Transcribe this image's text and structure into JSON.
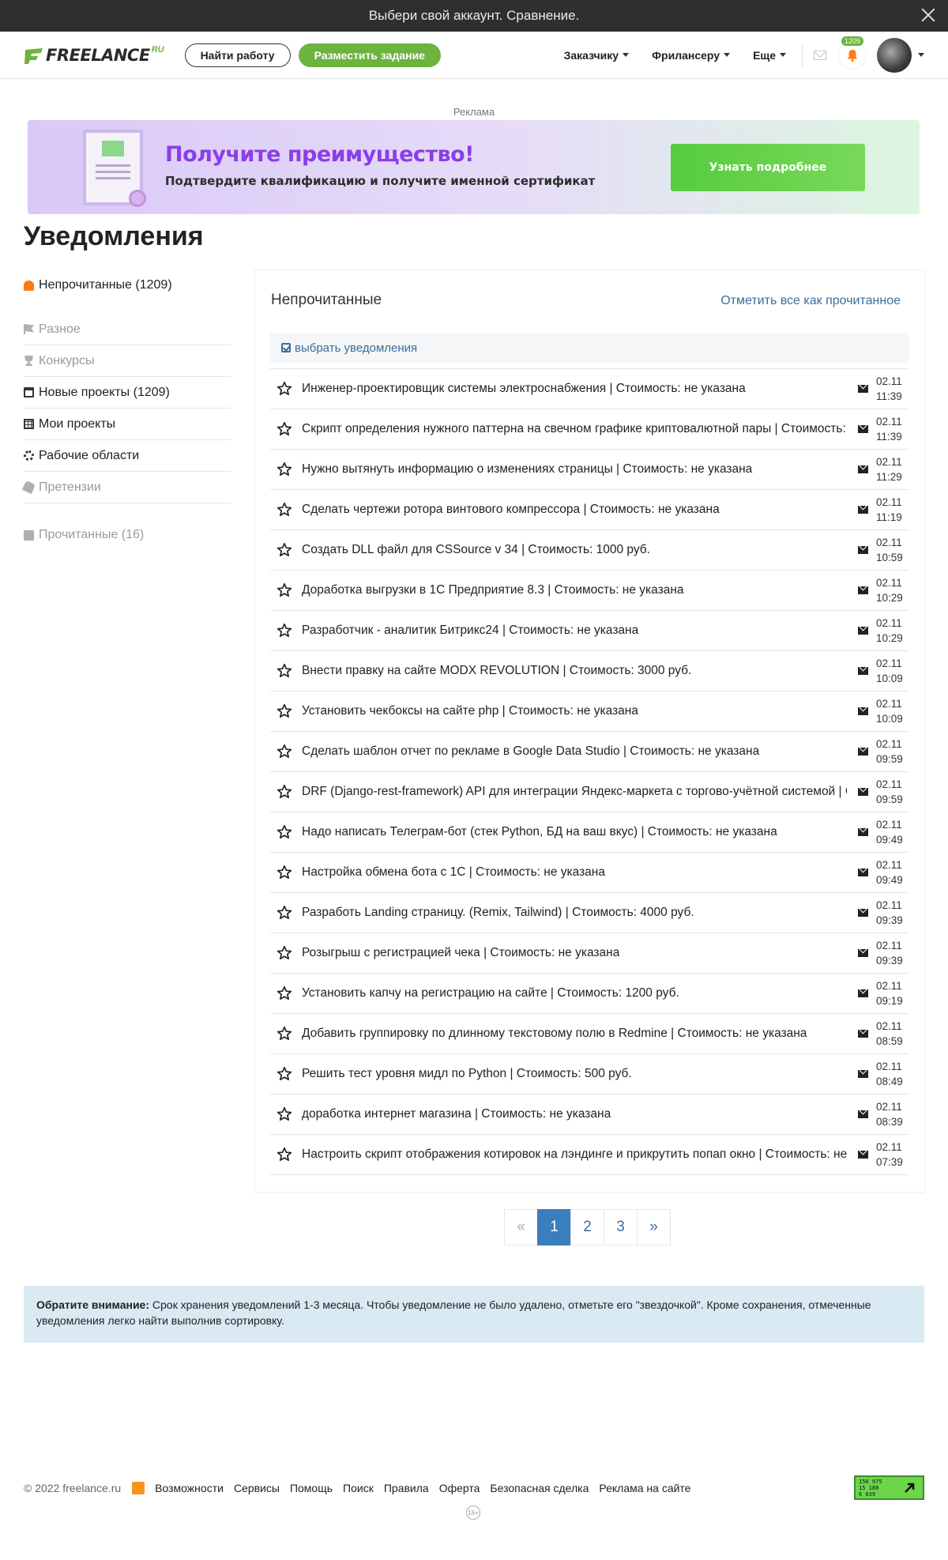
{
  "topbar": {
    "text": "Выбери свой аккаунт. Сравнение."
  },
  "header": {
    "logo_text": "FREELANCE",
    "logo_suffix": "RU",
    "find_work": "Найти работу",
    "post_task": "Разместить задание",
    "nav": [
      "Заказчику",
      "Фрилансеру",
      "Еще"
    ],
    "notification_count": "1209"
  },
  "ad": {
    "label": "Реклама",
    "title": "Получите преимущество!",
    "subtitle": "Подтвердите квалификацию и получите именной сертификат",
    "button": "Узнать подробнее"
  },
  "page_title": "Уведомления",
  "sidebar": {
    "unread": "Непрочитанные (1209)",
    "items": [
      {
        "label": "Разное",
        "icon": "flag-icon",
        "muted": true
      },
      {
        "label": "Конкурсы",
        "icon": "trophy-icon",
        "muted": true
      },
      {
        "label": "Новые проекты (1209)",
        "icon": "calendar-icon",
        "muted": false
      },
      {
        "label": "Мои проекты",
        "icon": "table-icon",
        "muted": false
      },
      {
        "label": "Рабочие области",
        "icon": "gears-icon",
        "muted": false
      },
      {
        "label": "Претензии",
        "icon": "brush-icon",
        "muted": true
      }
    ],
    "read": "Прочитанные (16)"
  },
  "main": {
    "title": "Непрочитанные",
    "mark_all": "Отметить все как прочитанное",
    "select": "выбрать уведомления",
    "notifications": [
      {
        "text": "Инженер-проектировщик системы электроснабжения | Стоимость: не указана",
        "date": "02.11",
        "time": "11:39"
      },
      {
        "text": "Скрипт определения нужного паттерна на свечном графике криптовалютной пары | Стоимость: не указана",
        "date": "02.11",
        "time": "11:39"
      },
      {
        "text": "Нужно вытянуть информацию о изменениях страницы | Стоимость: не указана",
        "date": "02.11",
        "time": "11:29"
      },
      {
        "text": "Сделать чертежи ротора винтового компрессора | Стоимость: не указана",
        "date": "02.11",
        "time": "11:19"
      },
      {
        "text": "Создать DLL файл для CSSource v 34 | Стоимость: 1000 руб.",
        "date": "02.11",
        "time": "10:59"
      },
      {
        "text": "Доработка выгрузки в 1С Предприятие 8.3 | Стоимость: не указана",
        "date": "02.11",
        "time": "10:29"
      },
      {
        "text": "Разработчик - аналитик Битрикс24 | Стоимость: не указана",
        "date": "02.11",
        "time": "10:29"
      },
      {
        "text": "Внести правку на сайте MODX REVOLUTION | Стоимость: 3000 руб.",
        "date": "02.11",
        "time": "10:09"
      },
      {
        "text": "Установить чекбоксы на сайте php | Стоимость: не указана",
        "date": "02.11",
        "time": "10:09"
      },
      {
        "text": "Сделать шаблон отчет по рекламе в Google Data Studio | Стоимость: не указана",
        "date": "02.11",
        "time": "09:59"
      },
      {
        "text": "DRF (Django-rest-framework) API для интеграции Яндекс-маркета с торгово-учётной системой | Стоимость: не указана",
        "date": "02.11",
        "time": "09:59"
      },
      {
        "text": "Надо написать Телеграм-бот (стек Python, БД на ваш вкус) | Стоимость: не указана",
        "date": "02.11",
        "time": "09:49"
      },
      {
        "text": "Настройка обмена бота с 1С | Стоимость: не указана",
        "date": "02.11",
        "time": "09:49"
      },
      {
        "text": "Разработь Landing страницу. (Remix, Tailwind) | Стоимость: 4000 руб.",
        "date": "02.11",
        "time": "09:39"
      },
      {
        "text": "Розыгрыш с регистрацией чека | Стоимость: не указана",
        "date": "02.11",
        "time": "09:39"
      },
      {
        "text": "Установить капчу на регистрацию на сайте | Стоимость: 1200 руб.",
        "date": "02.11",
        "time": "09:19"
      },
      {
        "text": "Добавить группировку по длинному текстовому полю в Redmine | Стоимость: не указана",
        "date": "02.11",
        "time": "08:59"
      },
      {
        "text": "Решить тест уровня мидл по Python | Стоимость: 500 руб.",
        "date": "02.11",
        "time": "08:49"
      },
      {
        "text": "доработка интернет магазина | Стоимость: не указана",
        "date": "02.11",
        "time": "08:39"
      },
      {
        "text": "Настроить скрипт отображения котировок на лэндинге и прикрутить попап окно | Стоимость: не указана",
        "date": "02.11",
        "time": "07:39"
      }
    ]
  },
  "pagination": {
    "prev": "«",
    "pages": [
      "1",
      "2",
      "3"
    ],
    "current": "1",
    "next": "»"
  },
  "notice": {
    "bold": "Обратите внимание:",
    "text": " Срок хранения уведомлений 1-3 месяца. Чтобы уведомление не было удалено, отметьте его \"звездочкой\". Кроме сохранения, отмеченные уведомления легко найти выполнив сортировку."
  },
  "footer": {
    "copyright": "© 2022 freelance.ru",
    "links": [
      "Возможности",
      "Сервисы",
      "Помощь",
      "Поиск",
      "Правила",
      "Оферта",
      "Безопасная сделка",
      "Реклама на сайте"
    ],
    "counter_lines": [
      "156 975",
      "15 188",
      "6 039"
    ],
    "age": "16+"
  },
  "colors": {
    "accent_green": "#6db33f",
    "link_blue": "#3b6e9c",
    "notice_bg": "#daeaf3",
    "bell_orange": "#ff7a14"
  }
}
